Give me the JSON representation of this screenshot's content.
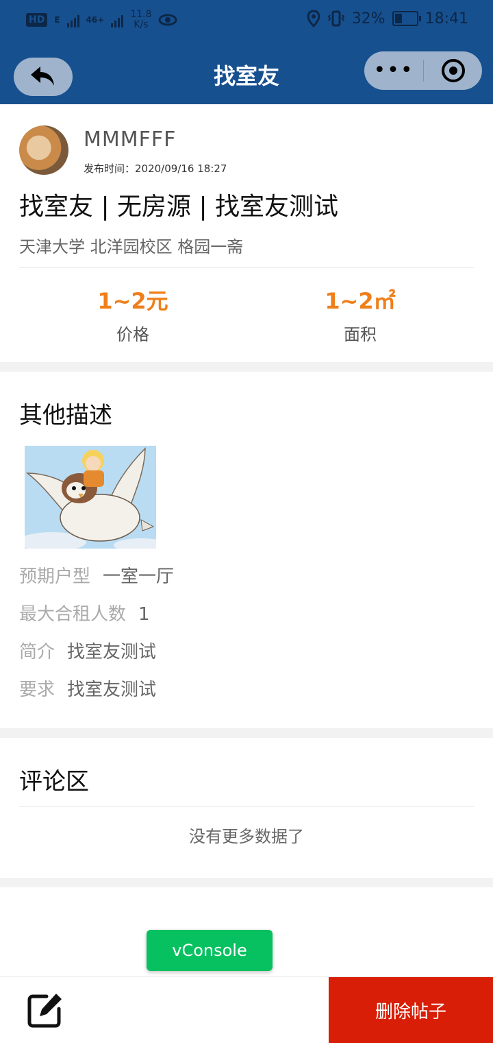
{
  "status_bar": {
    "hd_badge": "HD",
    "network_e": "E",
    "network_4g": "46+",
    "speed_value": "11.8",
    "speed_unit": "K/s",
    "battery_percent": "32%",
    "battery_level": 0.32,
    "time": "18:41"
  },
  "nav": {
    "title": "找室友",
    "more_label": "•••"
  },
  "post": {
    "username": "MMMFFF",
    "publish_time": "发布时间：2020/09/16 18:27",
    "title": "找室友 | 无房源 | 找室友测试",
    "location": "天津大学 北洋园校区 格园一斋",
    "price_value": "1~2元",
    "price_label": "价格",
    "area_value": "1~2㎡",
    "area_label": "面积"
  },
  "description": {
    "title": "其他描述",
    "items": [
      {
        "key": "预期户型",
        "value": "一室一厅"
      },
      {
        "key": "最大合租人数",
        "value": "1"
      },
      {
        "key": "简介",
        "value": "找室友测试"
      },
      {
        "key": "要求",
        "value": "找室友测试"
      }
    ]
  },
  "comments": {
    "title": "评论区",
    "empty_text": "没有更多数据了"
  },
  "vconsole_label": "vConsole",
  "bottom": {
    "delete_label": "删除帖子"
  },
  "colors": {
    "nav_bg": "#17508f",
    "accent_orange": "#ef7f1a",
    "delete_red": "#d81e06",
    "vconsole_green": "#07c160"
  }
}
